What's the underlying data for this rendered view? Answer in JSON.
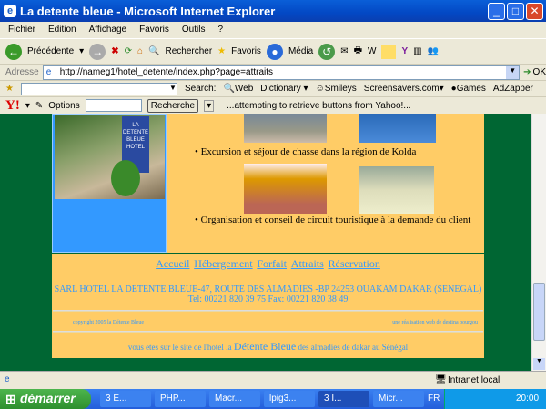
{
  "window": {
    "title": "La detente bleue - Microsoft Internet Explorer"
  },
  "menu": [
    "Fichier",
    "Edition",
    "Affichage",
    "Favoris",
    "Outils",
    "?"
  ],
  "toolbar": {
    "back": "Précédente",
    "search": "Rechercher",
    "favorites": "Favoris",
    "media": "Média"
  },
  "address": {
    "label": "Adresse",
    "url": "http://nameg1/hotel_detente/index.php?page=attraits",
    "go": "OK"
  },
  "searchbar": {
    "label": "Search:",
    "items": [
      "Web",
      "Dictionary",
      "Smileys",
      "Screensavers.com",
      "Games",
      "AdZapper"
    ]
  },
  "yahoo": {
    "logo": "Y!",
    "options": "Options",
    "button": "Recherche",
    "status": "...attempting to retrieve buttons from Yahoo!..."
  },
  "content": {
    "sign_text": "LA DETENTE BLEUE HOTEL",
    "bullets": [
      "Excursion et séjour de chasse dans la région de Kolda",
      "Organisation et conseil de circuit touristique à la demande du client"
    ]
  },
  "footer": {
    "nav": [
      "Accueil",
      "Hébergement",
      "Forfait",
      "Attraits",
      "Réservation"
    ],
    "address": "SARL HOTEL LA DETENTE BLEUE-47, ROUTE DES ALMADIES -BP 24253 OUAKAM DAKAR (SENEGAL)",
    "phone": "Tel: 00221 820 39 75 Fax: 00221 820 38 49",
    "copyright": "copyright 2005 la Détente Bleue",
    "credit": "une réalisation web de destina bourgou",
    "tagline_pre": "vous etes sur le site de l'hotel la",
    "tagline_name": "Détente Bleue",
    "tagline_post": "des almadies de dakar au Sénégal"
  },
  "status": {
    "zone": "Intranet local"
  },
  "taskbar": {
    "start": "démarrer",
    "tasks": [
      "3 E...",
      "PHP...",
      "Macr...",
      "lpig3...",
      "3 I...",
      "Micr..."
    ],
    "lang": "FR",
    "clock": "20:00"
  }
}
